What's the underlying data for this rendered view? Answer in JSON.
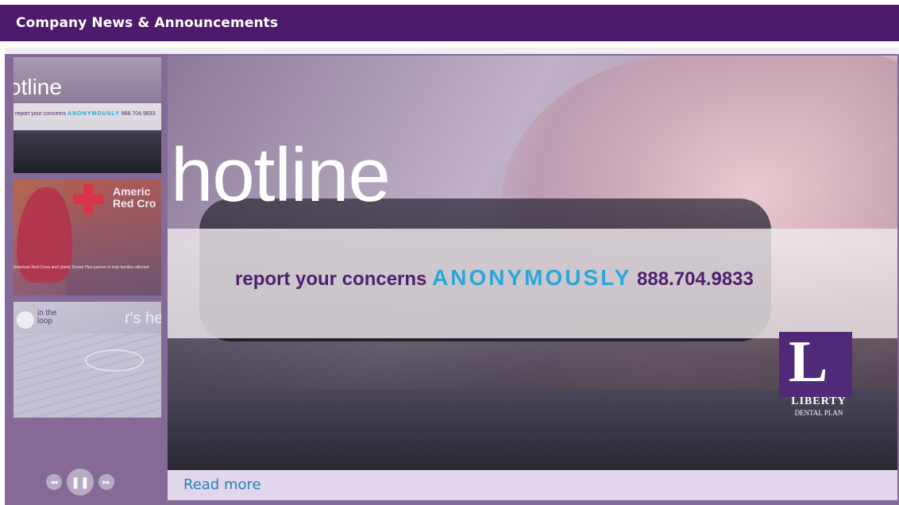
{
  "header": {
    "title": "Company News & Announcements"
  },
  "thumbnails": [
    {
      "title": "otline",
      "tagline_pre": "report your concerns ",
      "tagline_anon": "ANONYMOUSLY",
      "tagline_phone": " 888.704.9833"
    },
    {
      "org_line1": "Americ",
      "org_line2": "Red Cro",
      "caption": "American Red Cross and Liberty Dental Plan partner to help families affected"
    },
    {
      "loop_line1": "in the",
      "loop_line2": "loop",
      "title": "r's he"
    }
  ],
  "controls": {
    "prev_icon": "◂◂",
    "pause_icon": "❚❚",
    "next_icon": "▸▸"
  },
  "slide": {
    "headline": "hotline",
    "tagline_pre": "report your concerns ",
    "tagline_anon": "ANONYMOUSLY",
    "tagline_phone": " 888.704.9833",
    "logo_letter": "L",
    "logo_name": "LIBERTY",
    "logo_sub": "DENTAL PLAN"
  },
  "read_more": "Read more",
  "colors": {
    "header": "#4e1a6b",
    "frame": "#856997",
    "accent": "#2aa7da",
    "link": "#2e7fb8"
  }
}
